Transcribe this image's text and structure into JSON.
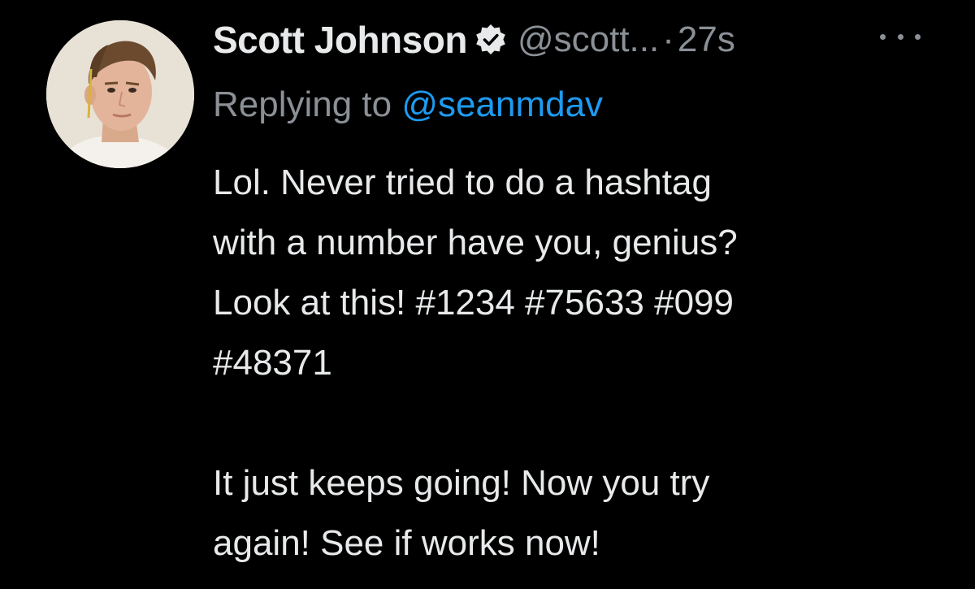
{
  "tweet": {
    "author": {
      "display_name": "Scott Johnson",
      "verified_icon": "verified-badge-icon",
      "handle": "@scott...",
      "separator": "·",
      "timestamp": "27s"
    },
    "more_icon": "more-horizontal-icon",
    "reply": {
      "prefix": "Replying to",
      "target": "@seanmdav"
    },
    "body": {
      "paragraph1": [
        "Lol. Never tried to do a hashtag",
        "with a number have you, genius?",
        "Look at this! #1234 #75633 #099",
        "#48371"
      ],
      "paragraph2": [
        "It just keeps going! Now you try",
        "again! See if works now!"
      ]
    }
  },
  "colors": {
    "background": "#000000",
    "primary_text": "#e7e9ea",
    "secondary_text": "#8b9096",
    "link": "#1d9bf0"
  }
}
